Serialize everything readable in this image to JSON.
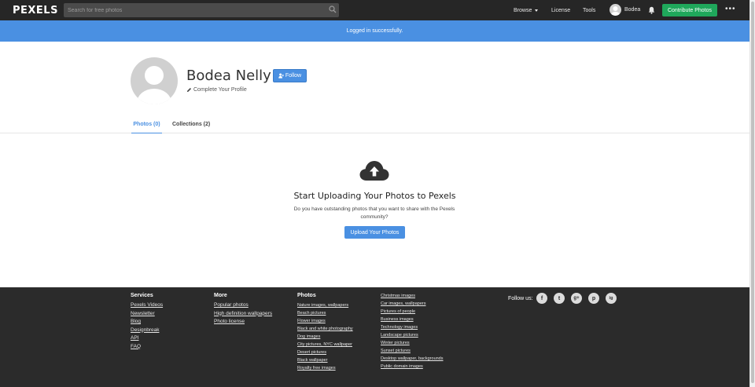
{
  "header": {
    "logo": "PEXELS",
    "search_placeholder": "Search for free photos",
    "browse": "Browse",
    "license": "License",
    "tools": "Tools",
    "username": "Bodea",
    "contribute": "Contribute Photos",
    "more": "•••"
  },
  "banner": {
    "message": "Logged in successfully."
  },
  "profile": {
    "name": "Bodea Nelly",
    "follow_label": "Follow",
    "complete_profile": "Complete Your Profile"
  },
  "tabs": {
    "photos": "Photos (0)",
    "collections": "Collections (2)"
  },
  "empty_state": {
    "title": "Start Uploading Your Photos to Pexels",
    "description": "Do you have outstanding photos that you want to share with the Pexels community?",
    "upload_label": "Upload Your Photos"
  },
  "footer": {
    "services": {
      "heading": "Services",
      "links": [
        "Pexels Videos",
        "Newsletter",
        "Blog",
        "Designbreak",
        "API",
        "FAQ"
      ]
    },
    "more": {
      "heading": "More",
      "links": [
        "Popular photos",
        "High definition wallpapers",
        "Photo license"
      ]
    },
    "photos": {
      "heading": "Photos",
      "links": [
        "Nature images, wallpapers",
        "Beach pictures",
        "Flower images",
        "Black and white photography",
        "Dog images",
        "City pictures, NYC wallpaper",
        "Desert pictures",
        "Black wallpaper",
        "Royalty free images"
      ]
    },
    "photos2": {
      "links": [
        "Christmas images",
        "Car images, wallpapers",
        "Pictures of people",
        "Business images",
        "Technology images",
        "Landscape pictures",
        "Winter pictures",
        "Sunset pictures",
        "Desktop wallpaper, backgrounds",
        "Public domain images"
      ]
    },
    "follow_us": "Follow us:",
    "social": [
      "f",
      "t",
      "g+",
      "p",
      "ig"
    ]
  }
}
